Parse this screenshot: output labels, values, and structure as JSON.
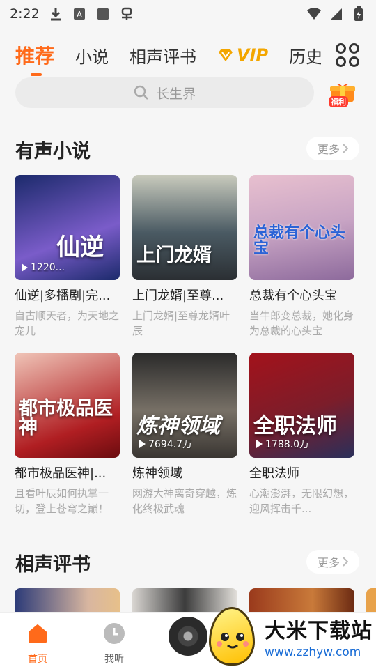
{
  "status_bar": {
    "time": "2:22"
  },
  "tabs": [
    {
      "label": "推荐",
      "active": true
    },
    {
      "label": "小说"
    },
    {
      "label": "相声评书"
    },
    {
      "label": "VIP"
    },
    {
      "label": "历史"
    }
  ],
  "search": {
    "placeholder": "长生界"
  },
  "gift": {
    "label": "福利"
  },
  "sections": [
    {
      "title": "有声小说",
      "more": "更多",
      "items": [
        {
          "title": "仙逆|多播剧|完...",
          "desc": "自古顺天者，为天地之宠儿",
          "plays": "1220...",
          "cover_text": "仙逆",
          "color_a": "#1b2a6b",
          "color_b": "#7a5cc9"
        },
        {
          "title": "上门龙婿|至尊...",
          "desc": "上门龙婿|至尊龙婿叶辰",
          "plays": "",
          "cover_text": "上门龙婿",
          "color_a": "#4a5a63",
          "color_b": "#c9cbbd"
        },
        {
          "title": "总裁有个心头宝",
          "desc": "当牛郎变总裁，她化身为总裁的心头宝",
          "plays": "",
          "cover_text": "总裁有个心头宝",
          "color_a": "#e8c0cf",
          "color_b": "#8d6a9c"
        },
        {
          "title": "都市极品医神|...",
          "desc": "且看叶辰如何执掌一切，登上苍穹之巅！",
          "plays": "",
          "cover_text": "都市极品医神",
          "color_a": "#b01e22",
          "color_b": "#f0c5b8"
        },
        {
          "title": "炼神领域",
          "desc": "网游大神离奇穿越，炼化终极武魂",
          "plays": "7694.7万",
          "cover_text": "炼神领域",
          "color_a": "#2a2a2a",
          "color_b": "#777066"
        },
        {
          "title": "全职法师",
          "desc": "心潮澎湃，无限幻想，迎风挥击千...",
          "plays": "1788.0万",
          "cover_text": "全职法师",
          "color_a": "#a3121b",
          "color_b": "#2a2f5a"
        }
      ]
    },
    {
      "title": "相声评书",
      "more": "更多"
    }
  ],
  "bottom_nav": [
    {
      "label": "首页",
      "active": true
    },
    {
      "label": "我听"
    }
  ],
  "watermark": {
    "title": "大米下载站",
    "url": "www.zzhyw.com"
  },
  "colors": {
    "accent": "#ff6a1a",
    "vip": "#f3a600"
  }
}
